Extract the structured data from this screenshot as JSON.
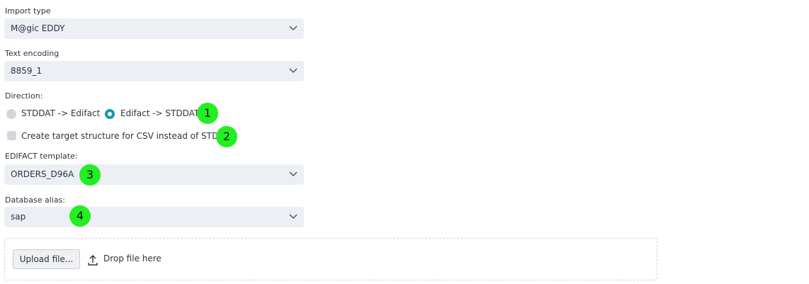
{
  "import_type": {
    "label": "Import type",
    "value": "M@gic EDDY"
  },
  "text_encoding": {
    "label": "Text encoding",
    "value": "8859_1"
  },
  "direction": {
    "label": "Direction:",
    "options": [
      {
        "label": "STDDAT -> Edifact",
        "selected": false
      },
      {
        "label": "Edifact -> STDDAT",
        "selected": true
      }
    ]
  },
  "csv_option": {
    "label": "Create target structure for CSV instead of STDAT",
    "checked": false
  },
  "edifact_template": {
    "label": "EDIFACT template:",
    "value": "ORDERS_D96A"
  },
  "database_alias": {
    "label": "Database alias:",
    "value": "sap"
  },
  "upload": {
    "button_label": "Upload file...",
    "drop_text": "Drop file here"
  },
  "annotations": [
    "1",
    "2",
    "3",
    "4"
  ],
  "colors": {
    "accent": "#1a93b5",
    "select_bg": "#eceff4",
    "badge": "#22ee22"
  },
  "icons": {
    "select_chevron": "chevron-down-icon",
    "upload": "upload-icon"
  }
}
